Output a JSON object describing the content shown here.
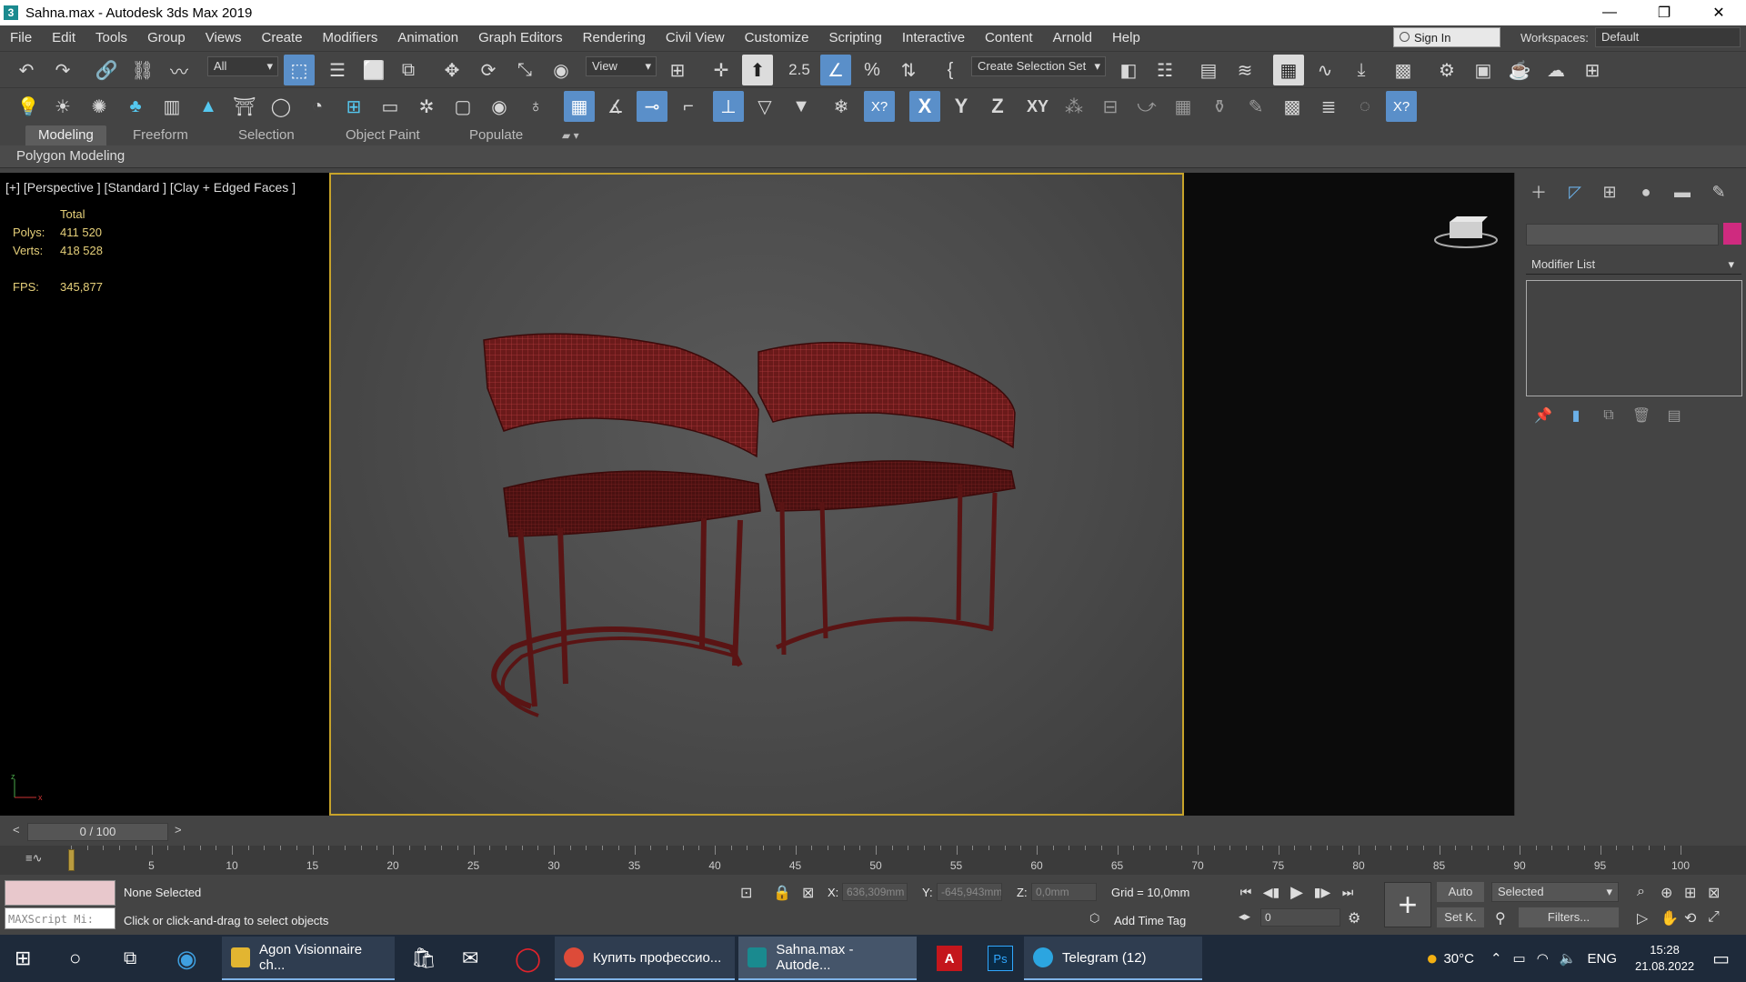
{
  "window": {
    "title": "Sahna.max - Autodesk 3ds Max 2019",
    "app_icon": "3"
  },
  "menu": [
    "File",
    "Edit",
    "Tools",
    "Group",
    "Views",
    "Create",
    "Modifiers",
    "Animation",
    "Graph Editors",
    "Rendering",
    "Civil View",
    "Customize",
    "Scripting",
    "Interactive",
    "Content",
    "Arnold",
    "Help"
  ],
  "account": {
    "signin_label": "Sign In",
    "workspaces_label": "Workspaces:",
    "workspace_value": "Default"
  },
  "toolbar": {
    "filter_value": "All",
    "refcoord_value": "View",
    "selection_set_placeholder": "Create Selection Set",
    "snap_label": "2.5",
    "axis_x": "X",
    "axis_y": "Y",
    "axis_z": "Z",
    "axis_xy": "XY"
  },
  "ribbon": {
    "tabs": [
      "Modeling",
      "Freeform",
      "Selection",
      "Object Paint",
      "Populate"
    ],
    "active_tab": "Modeling",
    "sub_label": "Polygon Modeling"
  },
  "viewport": {
    "label": "[+] [Perspective ] [Standard ] [Clay + Edged Faces ]",
    "stats_header": "Total",
    "polys_label": "Polys:",
    "polys_value": "411 520",
    "verts_label": "Verts:",
    "verts_value": "418 528",
    "fps_label": "FPS:",
    "fps_value": "345,877",
    "wire_color": "#9a2a2a"
  },
  "command_panel": {
    "modifier_list": "Modifier List",
    "object_color": "#cf2a7f"
  },
  "timeline": {
    "frame_display": "0 / 100",
    "current_frame": 0,
    "ticks": [
      5,
      10,
      15,
      20,
      25,
      30,
      35,
      40,
      45,
      50,
      55,
      60,
      65,
      70,
      75,
      80,
      85,
      90,
      95,
      100
    ]
  },
  "status": {
    "selection": "None Selected",
    "prompt": "Click or click-and-drag to select objects",
    "maxscript": "MAXScript Mi:",
    "x_label": "X:",
    "x_value": "636,309mm",
    "y_label": "Y:",
    "y_value": "-645,943mm",
    "z_label": "Z:",
    "z_value": "0,0mm",
    "grid": "Grid = 10,0mm",
    "add_time_tag": "Add Time Tag",
    "auto": "Auto",
    "set_key": "Set K.",
    "selected": "Selected",
    "filters": "Filters...",
    "frame_value": "0"
  },
  "taskbar": {
    "apps": [
      {
        "label": "Agon Visionnaire ch...",
        "color": "#e2b531"
      },
      {
        "label": "Купить профессио...",
        "color": "#dd4b39"
      },
      {
        "label": "Sahna.max - Autode...",
        "color": "#1a8a8f"
      },
      {
        "label": "Telegram (12)",
        "color": "#2ca5e0"
      }
    ],
    "temperature": "30°C",
    "language": "ENG",
    "time": "15:28",
    "date": "21.08.2022"
  }
}
